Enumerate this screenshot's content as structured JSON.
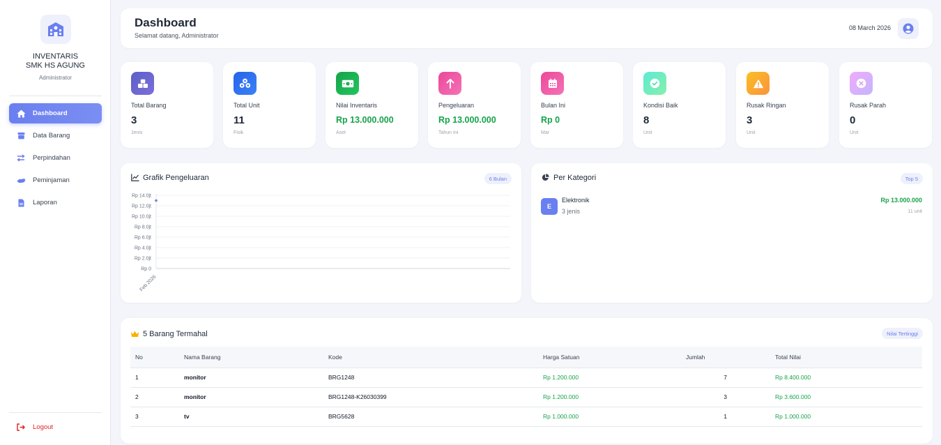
{
  "sidebar": {
    "brand_line1": "INVENTARIS",
    "brand_line2": "SMK HS AGUNG",
    "role": "Administrator",
    "items": [
      {
        "label": "Dashboard",
        "icon": "home-icon",
        "active": true
      },
      {
        "label": "Data Barang",
        "icon": "box-icon",
        "active": false
      },
      {
        "label": "Perpindahan",
        "icon": "exchange-icon",
        "active": false
      },
      {
        "label": "Peminjaman",
        "icon": "handshake-icon",
        "active": false
      },
      {
        "label": "Laporan",
        "icon": "file-icon",
        "active": false
      }
    ],
    "logout_label": "Logout"
  },
  "header": {
    "title": "Dashboard",
    "subtitle": "Selamat datang, Administrator",
    "date": "08 March 2026"
  },
  "stats": [
    {
      "label": "Total Barang",
      "value": "3",
      "note": "Jenis",
      "icon": "boxes-icon",
      "color_from": "#5b5fc7",
      "color_to": "#7c6fd9"
    },
    {
      "label": "Total Unit",
      "value": "11",
      "note": "Fisik",
      "icon": "cubes-icon",
      "color_from": "#2563eb",
      "color_to": "#3b82f6"
    },
    {
      "label": "Nilai Inventaris",
      "value": "Rp 13.000.000",
      "note": "Aset",
      "icon": "money-icon",
      "color_from": "#16a34a",
      "color_to": "#22c55e"
    },
    {
      "label": "Pengeluaran",
      "value": "Rp 13.000.000",
      "note": "Tahun Ini",
      "icon": "arrow-up-icon",
      "color_from": "#ec4899",
      "color_to": "#f472b6"
    },
    {
      "label": "Bulan Ini",
      "value": "Rp 0",
      "note": "Mar",
      "icon": "calendar-icon",
      "color_from": "#ec4899",
      "color_to": "#f472b6"
    },
    {
      "label": "Kondisi Baik",
      "value": "8",
      "note": "Unit",
      "icon": "check-circle-icon",
      "color_from": "#5eead4",
      "color_to": "#86efac"
    },
    {
      "label": "Rusak Ringan",
      "value": "3",
      "note": "Unit",
      "icon": "warning-icon",
      "color_from": "#fbbf24",
      "color_to": "#fb923c"
    },
    {
      "label": "Rusak Parah",
      "value": "0",
      "note": "Unit",
      "icon": "x-circle-icon",
      "color_from": "#f0abfc",
      "color_to": "#c4b5fd"
    }
  ],
  "chart_panel": {
    "title": "Grafik Pengeluaran",
    "badge": "6 Bulan"
  },
  "chart_data": {
    "type": "line",
    "categories": [
      "Feb 2026"
    ],
    "series": [
      {
        "values": [
          13000000
        ]
      }
    ],
    "y_ticks": [
      "Rp 0",
      "Rp 2.0jt",
      "Rp 4.0jt",
      "Rp 6.0jt",
      "Rp 8.0jt",
      "Rp 10.0jt",
      "Rp 12.0jt",
      "Rp 14.0jt"
    ],
    "ylim": [
      0,
      14000000
    ],
    "color": "#6a7ff0",
    "grid": true
  },
  "category_panel": {
    "title": "Per Kategori",
    "badge": "Top 5",
    "items": [
      {
        "badge": "E",
        "name": "Elektronik",
        "count": "3 jenis",
        "value": "Rp 13.000.000",
        "units": "11 unit"
      }
    ]
  },
  "top_panel": {
    "title": "5 Barang Termahal",
    "badge": "Nilai Tertinggi",
    "columns": [
      "No",
      "Nama Barang",
      "Kode",
      "Harga Satuan",
      "Jumlah",
      "Total Nilai"
    ],
    "rows": [
      {
        "no": "1",
        "name": "monitor",
        "kode": "BRG1248",
        "harga": "Rp 1.200.000",
        "jumlah": "7",
        "total": "Rp 8.400.000"
      },
      {
        "no": "2",
        "name": "monitor",
        "kode": "BRG1248-K26030399",
        "harga": "Rp 1.200.000",
        "jumlah": "3",
        "total": "Rp 3.600.000"
      },
      {
        "no": "3",
        "name": "tv",
        "kode": "BRG5628",
        "harga": "Rp 1.000.000",
        "jumlah": "1",
        "total": "Rp 1.000.000"
      }
    ]
  }
}
